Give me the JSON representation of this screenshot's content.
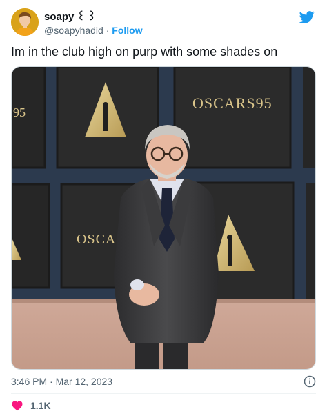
{
  "author": {
    "display_name": "soapy ꒰ ꒱",
    "handle": "@soapyhadid",
    "separator": " · ",
    "follow_label": "Follow"
  },
  "tweet": {
    "text": "Im in the club high on purp with some shades on",
    "timestamp": "3:46 PM · Mar 12, 2023",
    "like_count": "1.1K"
  },
  "photo": {
    "backdrop_text_left": "OSCARS95",
    "backdrop_text_right": "OSCARS95",
    "backdrop_text_partial": "OSCA",
    "backdrop_text_edge": "95"
  },
  "icons": {
    "brand": "twitter-bird-icon",
    "info": "info-icon",
    "like": "heart-icon"
  },
  "colors": {
    "accent": "#1d9bf0",
    "like": "#f91880",
    "text_primary": "#0f1419",
    "text_secondary": "#536471"
  }
}
